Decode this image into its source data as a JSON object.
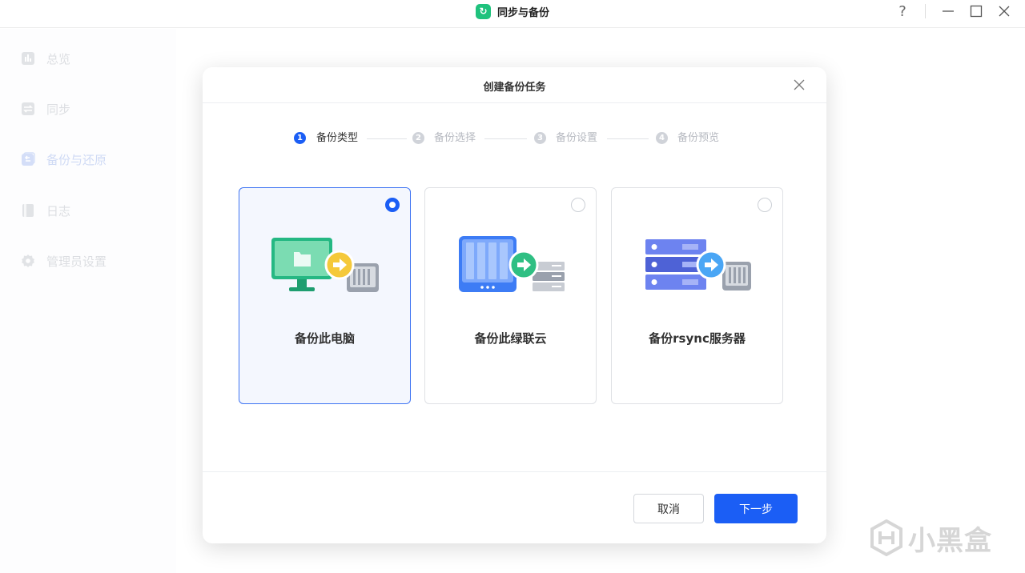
{
  "app": {
    "title": "同步与备份"
  },
  "window_controls": {
    "help": "?"
  },
  "sidebar": {
    "items": [
      {
        "label": "总览",
        "icon": "chart-icon"
      },
      {
        "label": "同步",
        "icon": "sync-icon"
      },
      {
        "label": "备份与还原",
        "icon": "backup-icon",
        "active": true
      },
      {
        "label": "日志",
        "icon": "log-icon"
      },
      {
        "label": "管理员设置",
        "icon": "gear-icon"
      }
    ]
  },
  "dialog": {
    "title": "创建备份任务",
    "steps": [
      {
        "num": "1",
        "label": "备份类型",
        "active": true
      },
      {
        "num": "2",
        "label": "备份选择"
      },
      {
        "num": "3",
        "label": "备份设置"
      },
      {
        "num": "4",
        "label": "备份预览"
      }
    ],
    "options": [
      {
        "label": "备份此电脑",
        "selected": true,
        "icon": "computer-to-nas-icon"
      },
      {
        "label": "备份此绿联云",
        "selected": false,
        "icon": "nas-to-server-icon"
      },
      {
        "label": "备份rsync服务器",
        "selected": false,
        "icon": "server-to-nas-icon"
      }
    ],
    "buttons": {
      "cancel": "取消",
      "next": "下一步"
    }
  },
  "watermark": {
    "text": "小黑盒"
  },
  "colors": {
    "accent": "#1b5ef5",
    "app_logo": "#1fc27d",
    "inactive_text": "#b9bcc4"
  }
}
